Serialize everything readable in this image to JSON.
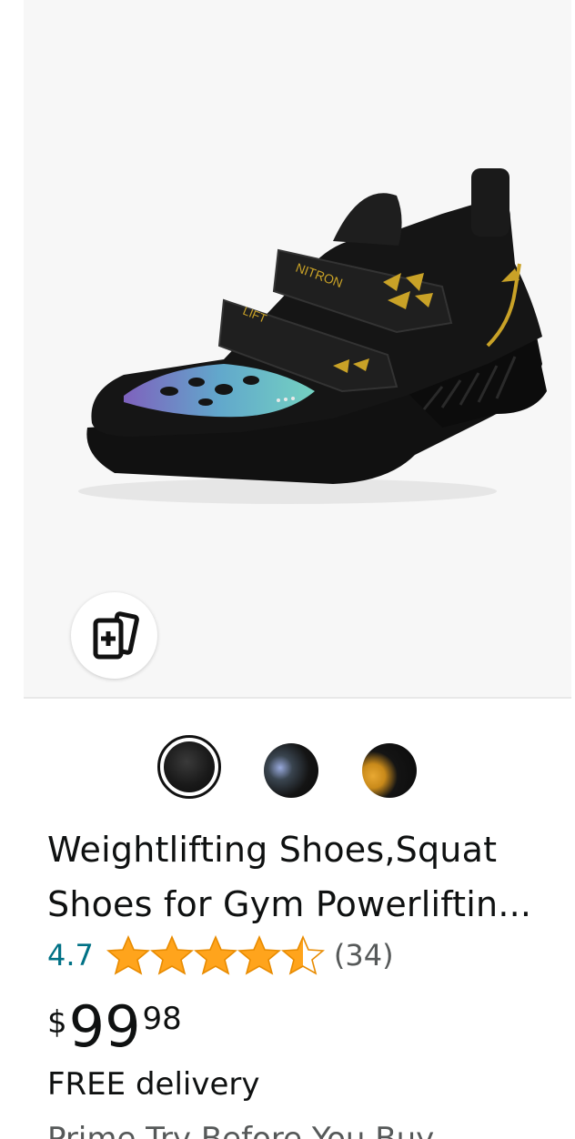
{
  "product": {
    "title_line1": "Weightlifting Shoes,Squat",
    "title_line2": "Shoes for Gym Powerliftin...",
    "rating": "4.7",
    "rating_stars": 4.5,
    "review_count": "(34)",
    "price": {
      "currency": "$",
      "whole": "99",
      "fraction": "98"
    },
    "delivery": "FREE delivery",
    "prime_text": "Prime Try Before You Buy"
  },
  "image": {
    "shoe_brand_text": "NITRON",
    "shoe_strap_text": "LIFT"
  },
  "swatches": [
    {
      "name": "black",
      "selected": true
    },
    {
      "name": "black-iridescent",
      "selected": false
    },
    {
      "name": "black-gold",
      "selected": false
    }
  ],
  "colors": {
    "star": "#ffa41c",
    "link": "#007185",
    "text": "#0f1111",
    "panel": "#f7f7f7"
  },
  "icons": {
    "compare": "add-to-compare-icon"
  }
}
